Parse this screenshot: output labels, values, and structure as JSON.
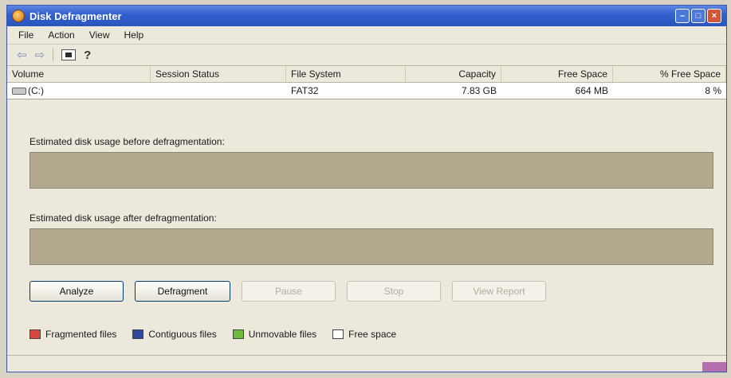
{
  "window": {
    "title": "Disk Defragmenter",
    "min": "–",
    "max": "□",
    "close": "×"
  },
  "menu": [
    "File",
    "Action",
    "View",
    "Help"
  ],
  "toolbar": {
    "back": "⇦",
    "forward": "⇨",
    "help": "?"
  },
  "table": {
    "headers": [
      "Volume",
      "Session Status",
      "File System",
      "Capacity",
      "Free Space",
      "% Free Space"
    ],
    "rows": [
      {
        "volume": "(C:)",
        "status": "",
        "fs": "FAT32",
        "capacity": "7.83 GB",
        "free": "664 MB",
        "pct": "8 %"
      }
    ]
  },
  "estimates": {
    "before_label": "Estimated disk usage before defragmentation:",
    "after_label": "Estimated disk usage after defragmentation:"
  },
  "buttons": {
    "analyze": "Analyze",
    "defragment": "Defragment",
    "pause": "Pause",
    "stop": "Stop",
    "report": "View Report"
  },
  "legend": [
    {
      "label": "Fragmented files",
      "color": "#d9473d"
    },
    {
      "label": "Contiguous files",
      "color": "#2d4a9a"
    },
    {
      "label": "Unmovable files",
      "color": "#6dbb3a"
    },
    {
      "label": "Free space",
      "color": "#ffffff"
    }
  ]
}
